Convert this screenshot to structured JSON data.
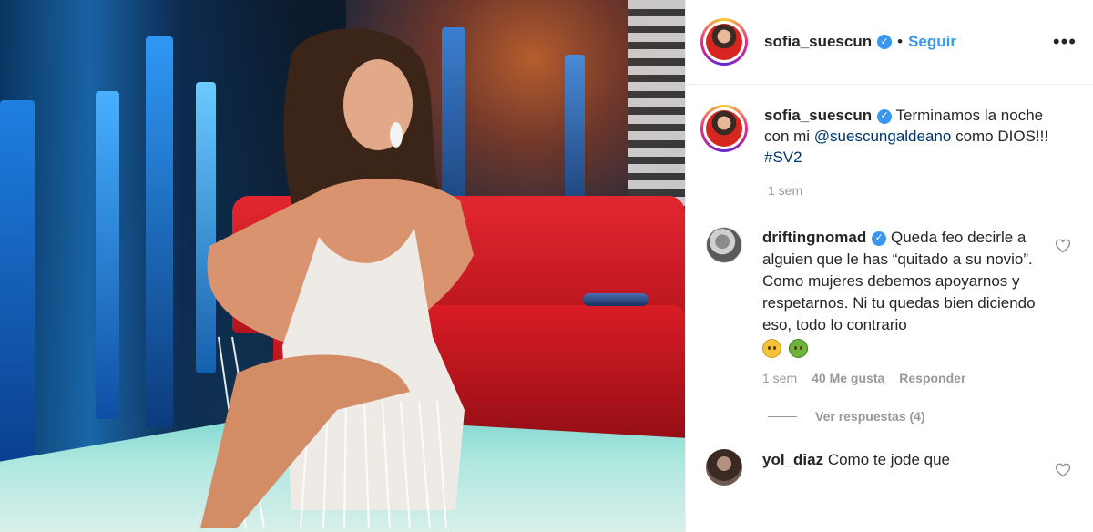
{
  "post": {
    "username": "sofia_suescun",
    "separator": "•",
    "follow_label": "Seguir",
    "more_label": "•••"
  },
  "caption": {
    "username": "sofia_suescun",
    "text_before": " Terminamos la noche con mi ",
    "mention": "@suescungaldeano",
    "text_after": " como DIOS!!! ",
    "hashtag": "#SV2",
    "time": "1 sem"
  },
  "comments": [
    {
      "username": "driftingnomad",
      "text": " Queda feo decirle a alguien que le has “quitado a su novio”. Como mujeres debemos apoyarnos y respetarnos. Ni tu quedas bien diciendo eso, todo lo contrario",
      "time": "1 sem",
      "likes": "40 Me gusta",
      "reply_label": "Responder",
      "view_replies": "Ver respuestas (4)"
    },
    {
      "username": "yol_diaz",
      "text": " Como te jode que"
    }
  ],
  "icons": {
    "verified": "verified-badge-icon",
    "heart": "heart-outline-icon",
    "more": "more-horizontal-icon"
  },
  "colors": {
    "link": "#3897f0",
    "mention": "#003569",
    "muted": "#999999",
    "verified": "#3897f0"
  }
}
